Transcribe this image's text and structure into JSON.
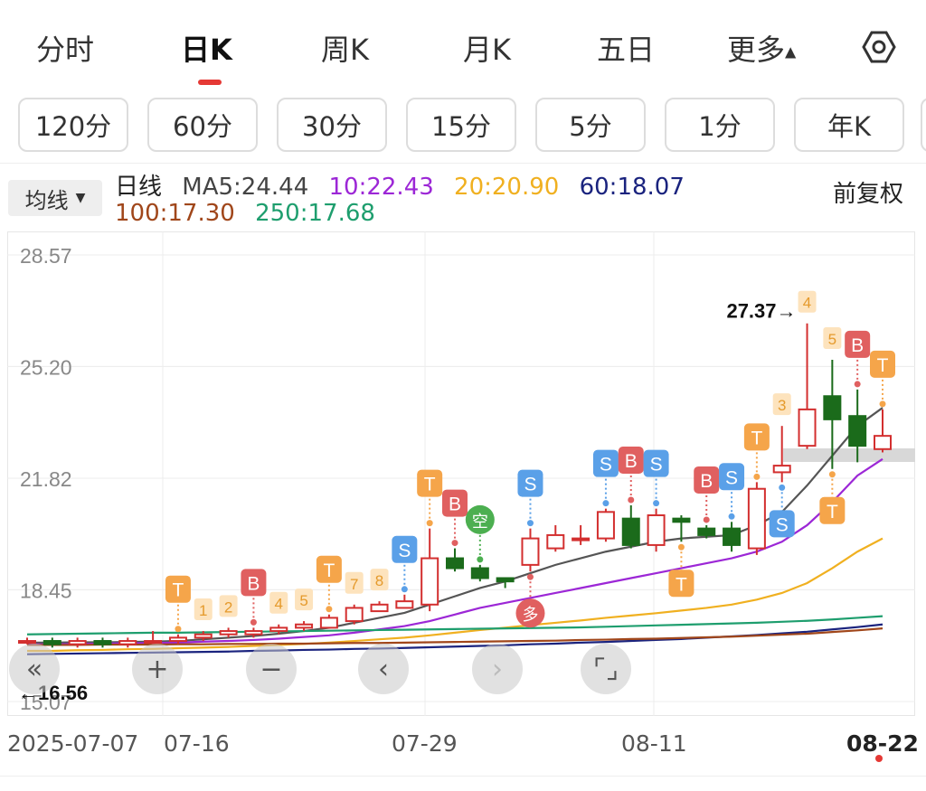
{
  "period_tabs": [
    "分时",
    "日K",
    "周K",
    "月K",
    "五日",
    "更多"
  ],
  "more_caret": "▲",
  "intervals": [
    "120分",
    "60分",
    "30分",
    "15分",
    "5分",
    "1分",
    "年K"
  ],
  "ma_select": {
    "label": "均线",
    "caret": "▼"
  },
  "legend": {
    "series_label": "日线",
    "ma5": "MA5:24.44",
    "ma10": "10:22.43",
    "ma20": "20:20.90",
    "ma60": "60:18.07",
    "ma100": "100:17.30",
    "ma250": "250:17.68",
    "adjust": "前复权"
  },
  "colors": {
    "up": "#d32f2f",
    "down": "#1b6b1b",
    "ma5": "#555555",
    "ma10": "#9c27d6",
    "ma20": "#f0b020",
    "ma60": "#1a237e",
    "ma100": "#a0461a",
    "ma250": "#1e9e6e",
    "signal_T": "#f5a54a",
    "signal_B": "#e06060",
    "signal_S": "#5aa0e8",
    "signal_kong": "#4caf50"
  },
  "chart_data": {
    "type": "candlestick",
    "y_ticks": [
      "28.57",
      "25.20",
      "21.82",
      "18.45",
      "15.07"
    ],
    "ylim": [
      15.07,
      28.57
    ],
    "x_labels": [
      "2025-07-07",
      "07-16",
      "07-29",
      "08-11",
      "08-22"
    ],
    "max_label": "27.37→",
    "min_label": "←16.56",
    "candles": [
      {
        "o": 16.9,
        "c": 16.9,
        "h": 17.0,
        "l": 16.8
      },
      {
        "o": 16.9,
        "c": 16.8,
        "h": 17.0,
        "l": 16.7
      },
      {
        "o": 16.8,
        "c": 16.9,
        "h": 17.0,
        "l": 16.7
      },
      {
        "o": 16.9,
        "c": 16.8,
        "h": 17.0,
        "l": 16.7
      },
      {
        "o": 16.8,
        "c": 16.9,
        "h": 17.0,
        "l": 16.7
      },
      {
        "o": 16.9,
        "c": 16.9,
        "h": 17.2,
        "l": 16.8
      },
      {
        "o": 16.9,
        "c": 17.0,
        "h": 17.1,
        "l": 16.8
      },
      {
        "o": 17.0,
        "c": 17.1,
        "h": 17.2,
        "l": 16.9
      },
      {
        "o": 17.1,
        "c": 17.2,
        "h": 17.3,
        "l": 17.0
      },
      {
        "o": 17.1,
        "c": 17.2,
        "h": 17.3,
        "l": 17.0
      },
      {
        "o": 17.2,
        "c": 17.3,
        "h": 17.4,
        "l": 17.1
      },
      {
        "o": 17.3,
        "c": 17.4,
        "h": 17.5,
        "l": 17.2
      },
      {
        "o": 17.3,
        "c": 17.6,
        "h": 17.7,
        "l": 17.3
      },
      {
        "o": 17.5,
        "c": 17.9,
        "h": 18.0,
        "l": 17.4
      },
      {
        "o": 17.8,
        "c": 18.0,
        "h": 18.1,
        "l": 17.8
      },
      {
        "o": 17.9,
        "c": 18.1,
        "h": 18.3,
        "l": 17.9
      },
      {
        "o": 18.0,
        "c": 19.4,
        "h": 20.3,
        "l": 17.8
      },
      {
        "o": 19.4,
        "c": 19.1,
        "h": 19.7,
        "l": 19.0
      },
      {
        "o": 19.1,
        "c": 18.8,
        "h": 19.2,
        "l": 18.7
      },
      {
        "o": 18.8,
        "c": 18.7,
        "h": 18.8,
        "l": 18.5
      },
      {
        "o": 19.2,
        "c": 20.0,
        "h": 20.3,
        "l": 19.0
      },
      {
        "o": 19.7,
        "c": 20.1,
        "h": 20.4,
        "l": 19.6
      },
      {
        "o": 20.0,
        "c": 20.0,
        "h": 20.4,
        "l": 19.8
      },
      {
        "o": 20.0,
        "c": 20.8,
        "h": 20.9,
        "l": 19.9
      },
      {
        "o": 20.6,
        "c": 19.8,
        "h": 21.0,
        "l": 19.7
      },
      {
        "o": 19.8,
        "c": 20.7,
        "h": 20.9,
        "l": 19.6
      },
      {
        "o": 20.6,
        "c": 20.5,
        "h": 20.7,
        "l": 19.9
      },
      {
        "o": 20.3,
        "c": 20.1,
        "h": 20.4,
        "l": 20.0
      },
      {
        "o": 20.3,
        "c": 19.8,
        "h": 20.5,
        "l": 19.6
      },
      {
        "o": 19.7,
        "c": 21.5,
        "h": 21.7,
        "l": 19.5
      },
      {
        "o": 22.0,
        "c": 22.2,
        "h": 23.4,
        "l": 21.7
      },
      {
        "o": 22.8,
        "c": 23.9,
        "h": 26.5,
        "l": 22.7
      },
      {
        "o": 24.3,
        "c": 23.6,
        "h": 25.4,
        "l": 22.1
      },
      {
        "o": 23.7,
        "c": 22.8,
        "h": 24.5,
        "l": 22.3
      },
      {
        "o": 22.7,
        "c": 23.1,
        "h": 23.9,
        "l": 22.6
      }
    ],
    "ma_series": [
      {
        "key": "ma5",
        "values": [
          16.85,
          16.85,
          16.86,
          16.86,
          16.87,
          16.88,
          16.9,
          16.95,
          17.0,
          17.05,
          17.12,
          17.2,
          17.3,
          17.45,
          17.6,
          17.75,
          18.0,
          18.25,
          18.5,
          18.7,
          18.95,
          19.2,
          19.4,
          19.6,
          19.75,
          19.9,
          20.0,
          20.05,
          20.1,
          20.4,
          20.8,
          21.6,
          22.5,
          23.4,
          23.95
        ]
      },
      {
        "key": "ma10",
        "values": [
          16.8,
          16.8,
          16.81,
          16.82,
          16.83,
          16.84,
          16.85,
          16.88,
          16.9,
          16.93,
          16.97,
          17.02,
          17.07,
          17.15,
          17.25,
          17.35,
          17.5,
          17.7,
          17.9,
          18.05,
          18.2,
          18.35,
          18.5,
          18.65,
          18.8,
          18.95,
          19.1,
          19.25,
          19.4,
          19.6,
          19.9,
          20.4,
          21.1,
          21.9,
          22.4
        ]
      },
      {
        "key": "ma20",
        "values": [
          16.6,
          16.6,
          16.62,
          16.63,
          16.65,
          16.66,
          16.68,
          16.7,
          16.72,
          16.75,
          16.78,
          16.81,
          16.85,
          16.9,
          16.95,
          17.0,
          17.07,
          17.15,
          17.23,
          17.3,
          17.38,
          17.45,
          17.52,
          17.6,
          17.67,
          17.74,
          17.82,
          17.9,
          18.0,
          18.15,
          18.35,
          18.65,
          19.1,
          19.6,
          20.0
        ]
      },
      {
        "key": "ma60",
        "values": [
          16.5,
          16.51,
          16.52,
          16.53,
          16.54,
          16.55,
          16.56,
          16.57,
          16.58,
          16.6,
          16.61,
          16.63,
          16.64,
          16.66,
          16.67,
          16.69,
          16.71,
          16.73,
          16.75,
          16.77,
          16.8,
          16.82,
          16.85,
          16.87,
          16.9,
          16.93,
          16.96,
          17.0,
          17.04,
          17.08,
          17.13,
          17.18,
          17.25,
          17.32,
          17.4
        ]
      },
      {
        "key": "ma100",
        "values": [
          16.78,
          16.78,
          16.78,
          16.79,
          16.79,
          16.79,
          16.8,
          16.8,
          16.81,
          16.81,
          16.82,
          16.82,
          16.83,
          16.84,
          16.84,
          16.85,
          16.86,
          16.87,
          16.88,
          16.89,
          16.9,
          16.91,
          16.93,
          16.94,
          16.96,
          16.97,
          16.99,
          17.01,
          17.03,
          17.06,
          17.09,
          17.12,
          17.17,
          17.22,
          17.28
        ]
      },
      {
        "key": "ma250",
        "values": [
          17.1,
          17.11,
          17.12,
          17.13,
          17.14,
          17.15,
          17.15,
          17.16,
          17.17,
          17.18,
          17.19,
          17.2,
          17.21,
          17.22,
          17.23,
          17.24,
          17.25,
          17.26,
          17.27,
          17.28,
          17.29,
          17.3,
          17.31,
          17.33,
          17.35,
          17.37,
          17.39,
          17.41,
          17.43,
          17.45,
          17.48,
          17.51,
          17.55,
          17.6,
          17.65
        ]
      }
    ],
    "signals": [
      {
        "i": 6,
        "text": "T",
        "kind": "T",
        "dir": "up"
      },
      {
        "i": 7,
        "text": "1",
        "kind": "num"
      },
      {
        "i": 8,
        "text": "2",
        "kind": "num"
      },
      {
        "i": 9,
        "text": "B",
        "kind": "B",
        "dir": "up"
      },
      {
        "i": 10,
        "text": "4",
        "kind": "num"
      },
      {
        "i": 11,
        "text": "5",
        "kind": "num"
      },
      {
        "i": 12,
        "text": "T",
        "kind": "T",
        "dir": "up"
      },
      {
        "i": 13,
        "text": "7",
        "kind": "num"
      },
      {
        "i": 14,
        "text": "8",
        "kind": "num"
      },
      {
        "i": 15,
        "text": "S",
        "kind": "S",
        "dir": "up"
      },
      {
        "i": 16,
        "text": "T",
        "kind": "T",
        "dir": "up"
      },
      {
        "i": 17,
        "text": "B",
        "kind": "B",
        "dir": "up"
      },
      {
        "i": 18,
        "text": "空",
        "kind": "kong",
        "dir": "up"
      },
      {
        "i": 20,
        "text": "S",
        "kind": "S",
        "dir": "up"
      },
      {
        "i": 20,
        "text": "多",
        "kind": "duo",
        "dir": "down"
      },
      {
        "i": 23,
        "text": "S",
        "kind": "S",
        "dir": "up"
      },
      {
        "i": 24,
        "text": "B",
        "kind": "B",
        "dir": "up"
      },
      {
        "i": 25,
        "text": "S",
        "kind": "S",
        "dir": "up"
      },
      {
        "i": 26,
        "text": "T",
        "kind": "T",
        "dir": "down"
      },
      {
        "i": 27,
        "text": "B",
        "kind": "B",
        "dir": "up"
      },
      {
        "i": 28,
        "text": "S",
        "kind": "S",
        "dir": "up"
      },
      {
        "i": 29,
        "text": "T",
        "kind": "T",
        "dir": "up"
      },
      {
        "i": 30,
        "text": "3",
        "kind": "num"
      },
      {
        "i": 30,
        "text": "S",
        "kind": "S",
        "dir": "down"
      },
      {
        "i": 31,
        "text": "4",
        "kind": "num"
      },
      {
        "i": 32,
        "text": "5",
        "kind": "num"
      },
      {
        "i": 32,
        "text": "T",
        "kind": "T",
        "dir": "down"
      },
      {
        "i": 33,
        "text": "B",
        "kind": "B",
        "dir": "up"
      },
      {
        "i": 34,
        "text": "T",
        "kind": "T",
        "dir": "up"
      }
    ]
  },
  "overlay_controls": [
    "«",
    "+",
    "−",
    "‹",
    "›",
    "⌜⌟"
  ]
}
